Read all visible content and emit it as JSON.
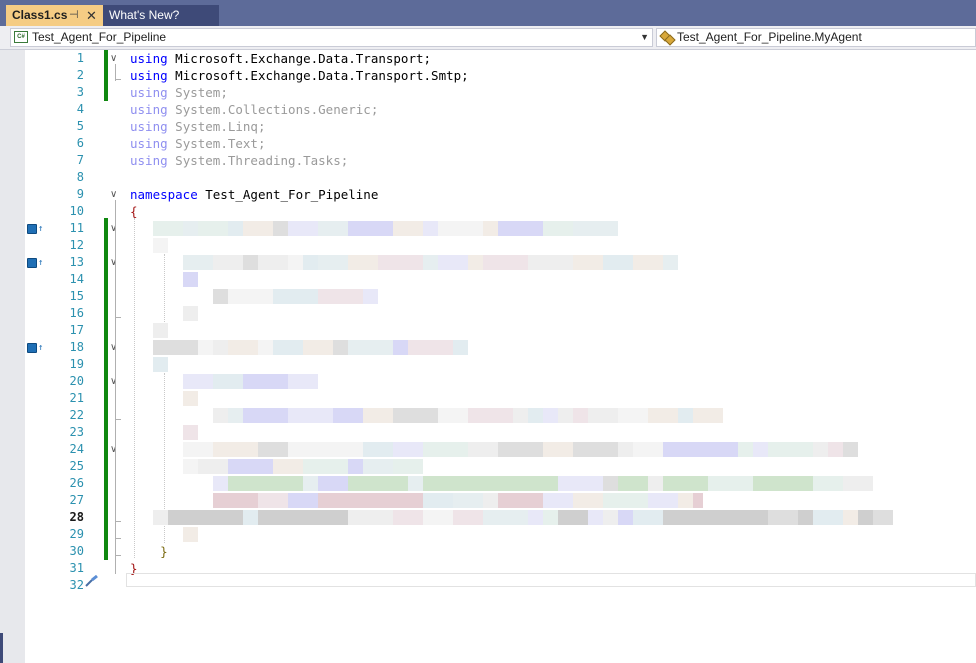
{
  "tabs": [
    {
      "label": "Class1.cs",
      "active": true,
      "pin_glyph": "⊣",
      "close_glyph": "✕"
    },
    {
      "label": "What's New?",
      "active": false
    }
  ],
  "navbar": {
    "project_dropdown": {
      "icon": "csharp-project-icon",
      "icon_text": "C#",
      "value": "Test_Agent_For_Pipeline",
      "arrow": "▼"
    },
    "member_dropdown": {
      "icon": "class-icon",
      "value": "Test_Agent_For_Pipeline.MyAgent"
    }
  },
  "editor": {
    "current_line": 28,
    "lines": [
      {
        "n": "1",
        "parts": [
          {
            "t": "using",
            "c": "kw"
          },
          {
            "t": " Microsoft.Exchange.Data.Transport;",
            "c": ""
          }
        ]
      },
      {
        "n": "2",
        "parts": [
          {
            "t": "using",
            "c": "kw"
          },
          {
            "t": " Microsoft.Exchange.Data.Transport.Smtp;",
            "c": ""
          }
        ]
      },
      {
        "n": "3",
        "parts": [
          {
            "t": "using",
            "c": "kw-faded"
          },
          {
            "t": " System;",
            "c": "txt-faded"
          }
        ]
      },
      {
        "n": "4",
        "parts": [
          {
            "t": "using",
            "c": "kw-faded"
          },
          {
            "t": " System.Collections.Generic;",
            "c": "txt-faded"
          }
        ]
      },
      {
        "n": "5",
        "parts": [
          {
            "t": "using",
            "c": "kw-faded"
          },
          {
            "t": " System.Linq;",
            "c": "txt-faded"
          }
        ]
      },
      {
        "n": "6",
        "parts": [
          {
            "t": "using",
            "c": "kw-faded"
          },
          {
            "t": " System.Text;",
            "c": "txt-faded"
          }
        ]
      },
      {
        "n": "7",
        "parts": [
          {
            "t": "using",
            "c": "kw-faded"
          },
          {
            "t": " System.Threading.Tasks;",
            "c": "txt-faded"
          }
        ]
      },
      {
        "n": "8",
        "parts": []
      },
      {
        "n": "9",
        "parts": [
          {
            "t": "namespace",
            "c": "kw"
          },
          {
            "t": " Test_Agent_For_Pipeline",
            "c": ""
          }
        ]
      },
      {
        "n": "10",
        "parts": [
          {
            "t": "{",
            "c": "brace"
          }
        ]
      },
      {
        "n": "11",
        "parts": []
      },
      {
        "n": "12",
        "parts": []
      },
      {
        "n": "13",
        "parts": []
      },
      {
        "n": "14",
        "parts": []
      },
      {
        "n": "15",
        "parts": []
      },
      {
        "n": "16",
        "parts": []
      },
      {
        "n": "17",
        "parts": []
      },
      {
        "n": "18",
        "parts": []
      },
      {
        "n": "19",
        "parts": []
      },
      {
        "n": "20",
        "parts": []
      },
      {
        "n": "21",
        "parts": []
      },
      {
        "n": "22",
        "parts": []
      },
      {
        "n": "23",
        "parts": []
      },
      {
        "n": "24",
        "parts": []
      },
      {
        "n": "25",
        "parts": []
      },
      {
        "n": "26",
        "parts": []
      },
      {
        "n": "27",
        "parts": []
      },
      {
        "n": "28",
        "parts": []
      },
      {
        "n": "29",
        "parts": []
      },
      {
        "n": "30",
        "parts": [
          {
            "t": "    }",
            "c": "brace-inner"
          }
        ]
      },
      {
        "n": "31",
        "parts": [
          {
            "t": "}",
            "c": "brace"
          }
        ]
      },
      {
        "n": "32",
        "parts": []
      }
    ],
    "codelens_lines": [
      11,
      13,
      18
    ],
    "codelens_icon": "codelens-reference-icon",
    "codelens_arrow": "↑",
    "fold_glyph": "∨",
    "fold_lines": [
      1,
      9,
      11,
      13,
      18,
      20,
      24
    ],
    "quick_action_icon": "screwdriver-icon",
    "redacted_note_lines": [
      11,
      12,
      13,
      14,
      15,
      16,
      17,
      18,
      19,
      20,
      21,
      22,
      23,
      24,
      25,
      26,
      27,
      28,
      29
    ]
  }
}
